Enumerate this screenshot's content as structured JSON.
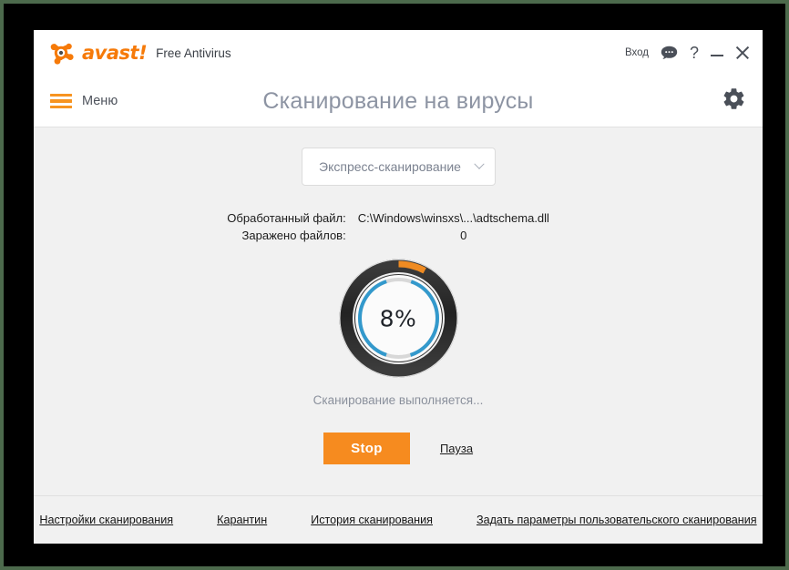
{
  "window": {
    "brand_word": "avast!",
    "product_name": "Free Antivirus",
    "login_label": "Вход",
    "help_label": "?",
    "logo_color": "#f67a09"
  },
  "header": {
    "menu_label": "Меню",
    "page_title": "Сканирование на вирусы"
  },
  "scan": {
    "type_selected": "Экспресс-сканирование",
    "processed_file_label": "Обработанный файл:",
    "processed_file_value": "C:\\Windows\\winsxs\\...\\adtschema.dll",
    "infected_label": "Заражено файлов:",
    "infected_value": "0",
    "progress_percent": "8%",
    "progress_value": 8,
    "status": "Сканирование выполняется...",
    "stop_label": "Stop",
    "pause_label": "Пауза",
    "accent_orange": "#f68b1f",
    "ring_blue": "#3399cc",
    "ring_dark": "#2b2b2b"
  },
  "footer": {
    "links": [
      "Настройки сканирования",
      "Карантин",
      "История сканирования",
      "Задать параметры пользовательского сканирования"
    ]
  }
}
